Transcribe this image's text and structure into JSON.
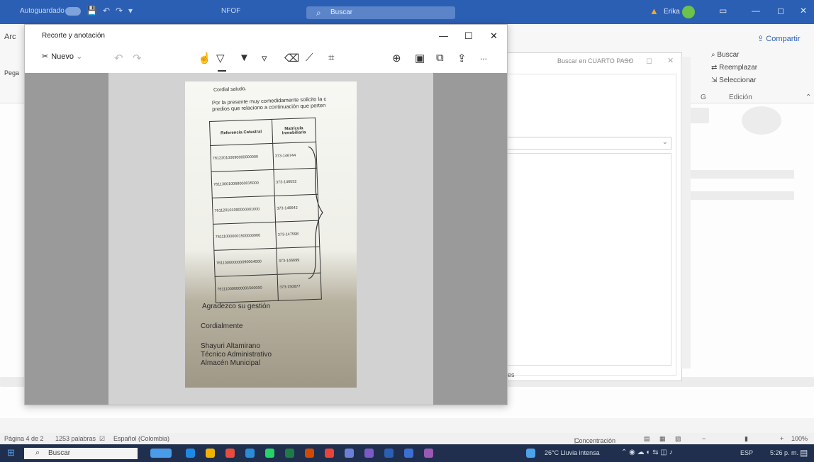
{
  "word_window": {
    "autosave_label": "Autoguardado",
    "doc_name": "NFOF",
    "search_placeholder": "Buscar",
    "user_name": "Erika",
    "share_label": "Compartir",
    "ribbon_tab_1": "Arc",
    "ribbon_tab_2": "Pega",
    "edit_search": "Buscar",
    "edit_replace": "Reemplazar",
    "edit_select": "Seleccionar",
    "group_label_g": "G",
    "group_label_edicion": "Edición"
  },
  "background_dialog": {
    "search_placeholder": "Buscar en CUARTO PASO",
    "footer_text": "es"
  },
  "snip_window": {
    "title": "Recorte y anotación",
    "new_label": "Nuevo",
    "more_label": "..."
  },
  "paper": {
    "greeting": "Cordial saludo.",
    "intro_line_1": "Por la presente muy comedidamente solicito la c",
    "intro_line_2": "predios que relaciono a continuación que perten",
    "table_headers": [
      "Referencia Catastral",
      "Matrícula Inmobiliaria"
    ],
    "table_rows": [
      [
        "761220100090000000000",
        "373-146744"
      ],
      [
        "761130010068000015000",
        "373-146552"
      ],
      [
        "761120101090000001000",
        "373-146642"
      ],
      [
        "761110000001500000000",
        "373-147598"
      ],
      [
        "761100000000090004000",
        "373-146699"
      ],
      [
        "761110000000001500000",
        "373-150677"
      ]
    ],
    "closing": "Agradezco su gestión",
    "farewell": "Cordialmente",
    "signature_name": "Shayuri Altamirano",
    "signature_role": "Técnico Administrativo",
    "signature_dept": "Almacén Municipal"
  },
  "status_bar": {
    "page": "Página 4 de 2",
    "words": "1253 palabras",
    "language": "Español (Colombia)",
    "focus": "Concentración",
    "zoom": "100%"
  },
  "taskbar": {
    "search_placeholder": "Buscar",
    "weather": "26°C Lluvia intensa",
    "lang": "ESP",
    "time": "5:26 p. m."
  }
}
